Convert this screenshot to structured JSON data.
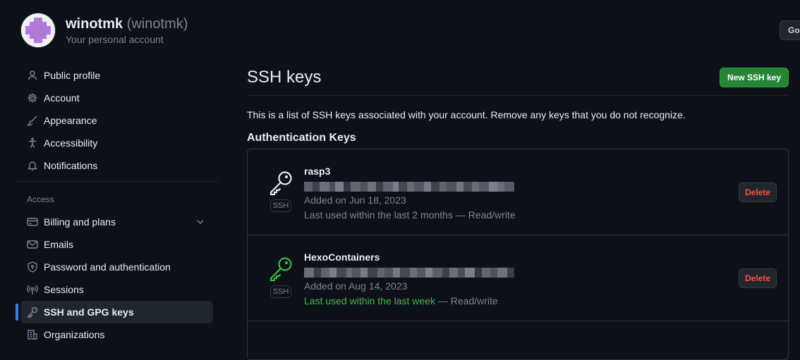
{
  "header": {
    "display_name": "winotmk",
    "login": "(winotmk)",
    "account_type": "Your personal account",
    "go_button_label": "Go"
  },
  "sidebar": {
    "items": [
      {
        "label": "Public profile",
        "icon": "person-icon"
      },
      {
        "label": "Account",
        "icon": "gear-icon"
      },
      {
        "label": "Appearance",
        "icon": "paintbrush-icon"
      },
      {
        "label": "Accessibility",
        "icon": "accessibility-icon"
      },
      {
        "label": "Notifications",
        "icon": "bell-icon"
      }
    ],
    "access_section_title": "Access",
    "access_items": [
      {
        "label": "Billing and plans",
        "icon": "credit-card-icon",
        "expandable": true
      },
      {
        "label": "Emails",
        "icon": "mail-icon"
      },
      {
        "label": "Password and authentication",
        "icon": "shield-lock-icon"
      },
      {
        "label": "Sessions",
        "icon": "broadcast-icon"
      },
      {
        "label": "SSH and GPG keys",
        "icon": "key-icon",
        "active": true
      },
      {
        "label": "Organizations",
        "icon": "organization-icon"
      }
    ]
  },
  "main": {
    "title": "SSH keys",
    "new_button_label": "New SSH key",
    "intro": "This is a list of SSH keys associated with your account. Remove any keys that you do not recognize.",
    "auth_heading": "Authentication Keys",
    "keys": [
      {
        "title": "rasp3",
        "badge": "SSH",
        "added": "Added on Jun 18, 2023",
        "last_used": "Last used within the last 2 months",
        "last_used_recent": false,
        "access": " — Read/write",
        "delete_label": "Delete",
        "icon_color": "#e6edf3"
      },
      {
        "title": "HexoContainers",
        "badge": "SSH",
        "added": "Added on Aug 14, 2023",
        "last_used": "Last used within the last week",
        "last_used_recent": true,
        "access": " — Read/write",
        "delete_label": "Delete",
        "icon_color": "#3fb950"
      }
    ]
  },
  "colors": {
    "background": "#0d1117",
    "accent_blue": "#2f81f7",
    "primary_green": "#238636",
    "danger_red": "#f85149",
    "muted": "#7d8590"
  }
}
